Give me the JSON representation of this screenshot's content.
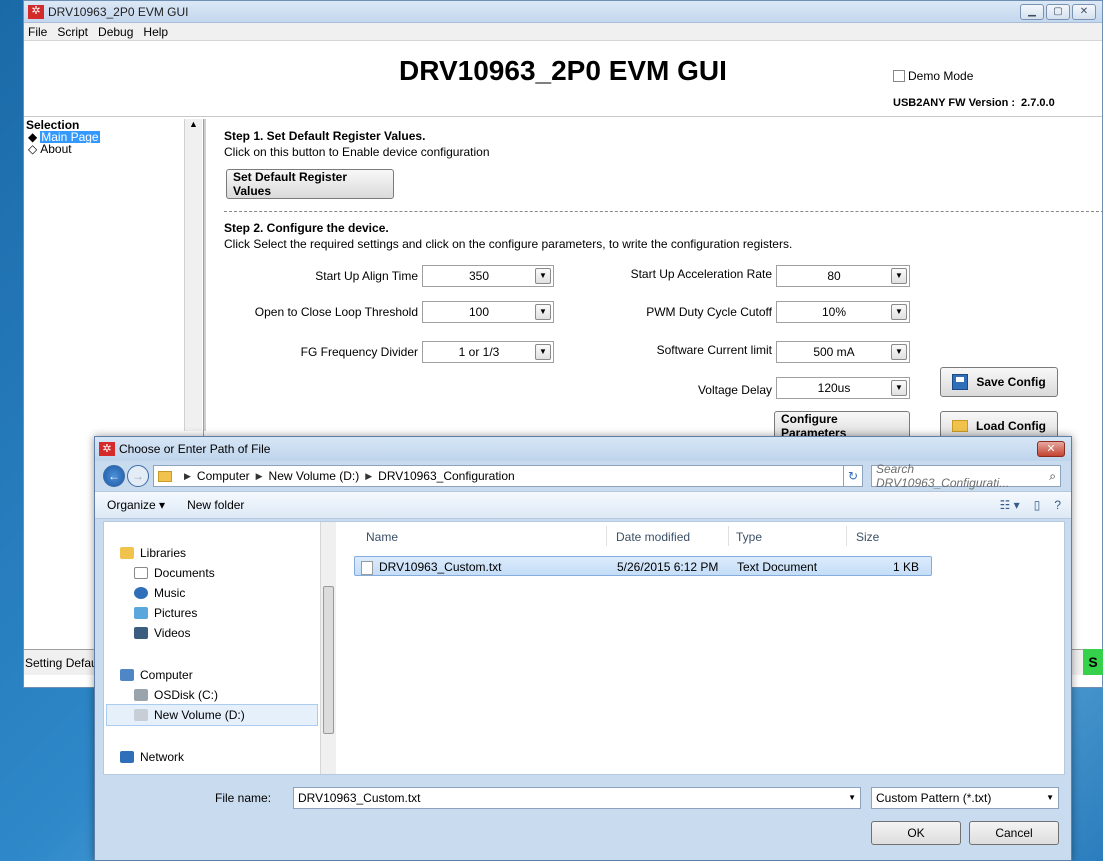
{
  "app": {
    "window_title": "DRV10963_2P0 EVM GUI",
    "icon_glyph": "✲",
    "menu": [
      "File",
      "Script",
      "Debug",
      "Help"
    ],
    "heading": "DRV10963_2P0 EVM GUI",
    "demo_mode_label": "Demo Mode",
    "fw_version_label": "USB2ANY FW Version :",
    "fw_version_value": "2.7.0.0"
  },
  "sidebar": {
    "title": "Selection",
    "items": [
      {
        "label": "Main Page",
        "bullet": "◆",
        "selected": true
      },
      {
        "label": "About",
        "bullet": "◇",
        "selected": false
      }
    ]
  },
  "content": {
    "step1": {
      "title": "Step 1.  Set Default Register Values.",
      "desc": "Click on this button to Enable device configuration",
      "button": "Set Default Register Values"
    },
    "step2": {
      "title": "Step 2.  Configure the device.",
      "desc": "Click Select the required settings and click on the configure parameters, to write the configuration registers."
    },
    "fields": {
      "startup_align_time": {
        "label": "Start Up Align Time",
        "value": "350"
      },
      "open_close_threshold": {
        "label": "Open to Close Loop Threshold",
        "value": "100"
      },
      "fg_freq_divider": {
        "label": "FG Frequency Divider",
        "value": "1 or 1/3"
      },
      "startup_accel_rate": {
        "label": "Start Up Acceleration Rate",
        "value": "80"
      },
      "pwm_duty_cutoff": {
        "label": "PWM Duty Cycle Cutoff",
        "value": "10%"
      },
      "sw_current_limit": {
        "label": "Software Current limit",
        "value": "500 mA"
      },
      "voltage_delay": {
        "label": "Voltage Delay",
        "value": "120us"
      }
    },
    "save_config": "Save Config",
    "load_config": "Load Config",
    "configure_parameters": "Configure Parameters"
  },
  "status": {
    "text": "Setting Defau",
    "badge": "S",
    "badge_color": "#35d14a"
  },
  "dialog": {
    "title": "Choose or Enter Path of File",
    "close_glyph": "✕",
    "breadcrumb": [
      "Computer",
      "New Volume (D:)",
      "DRV10963_Configuration"
    ],
    "search_placeholder": "Search DRV10963_Configurati...",
    "toolbar": {
      "organize": "Organize ▾",
      "new_folder": "New folder"
    },
    "nav": {
      "libraries": "Libraries",
      "documents": "Documents",
      "music": "Music",
      "pictures": "Pictures",
      "videos": "Videos",
      "computer": "Computer",
      "osdisk": "OSDisk (C:)",
      "new_volume": "New Volume (D:)",
      "network": "Network"
    },
    "columns": {
      "name": "Name",
      "date": "Date modified",
      "type": "Type",
      "size": "Size"
    },
    "files": [
      {
        "name": "DRV10963_Custom.txt",
        "date": "5/26/2015 6:12 PM",
        "type": "Text Document",
        "size": "1 KB"
      }
    ],
    "file_name_label": "File name:",
    "file_name_value": "DRV10963_Custom.txt",
    "filter": "Custom Pattern (*.txt)",
    "ok": "OK",
    "cancel": "Cancel"
  }
}
